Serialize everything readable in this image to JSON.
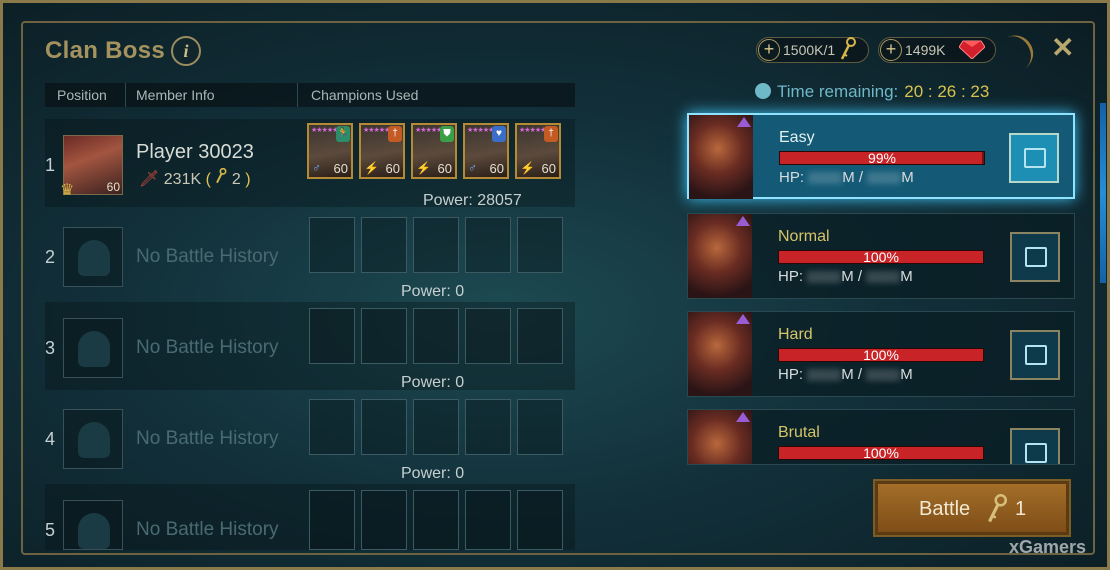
{
  "header": {
    "title": "Clan Boss",
    "info_icon": "i",
    "close_icon": "✕"
  },
  "resources": [
    {
      "value": "1500K/1",
      "icon": "key-icon"
    },
    {
      "value": "1499K",
      "icon": "ruby-icon"
    }
  ],
  "time": {
    "label": "Time remaining:",
    "value": "20 : 26 : 23"
  },
  "columns": {
    "position": "Position",
    "member": "Member Info",
    "champions": "Champions Used"
  },
  "rows": [
    {
      "num": "1",
      "name": "Player 30023",
      "level": "60",
      "damage": "231K",
      "keys": "2",
      "power": "Power: 28057",
      "champions": [
        {
          "level": "60",
          "stars": "★★★★★★"
        },
        {
          "level": "60",
          "stars": "★★★★★★"
        },
        {
          "level": "60",
          "stars": "★★★★★★"
        },
        {
          "level": "60",
          "stars": "★★★★★★"
        },
        {
          "level": "60",
          "stars": "★★★★★★"
        }
      ]
    },
    {
      "num": "2",
      "name": "No Battle History",
      "power": "Power: 0"
    },
    {
      "num": "3",
      "name": "No Battle History",
      "power": "Power: 0"
    },
    {
      "num": "4",
      "name": "No Battle History",
      "power": "Power: 0"
    },
    {
      "num": "5",
      "name": "No Battle History"
    }
  ],
  "difficulties": [
    {
      "name": "Easy",
      "hp_percent": 99,
      "hp_label": "99%",
      "hp_prefix": "HP:",
      "hp_sep": "M /",
      "hp_unit": "M"
    },
    {
      "name": "Normal",
      "hp_percent": 100,
      "hp_label": "100%",
      "hp_prefix": "HP:",
      "hp_sep": "M /",
      "hp_unit": "M"
    },
    {
      "name": "Hard",
      "hp_percent": 100,
      "hp_label": "100%",
      "hp_prefix": "HP:",
      "hp_sep": "M /",
      "hp_unit": "M"
    },
    {
      "name": "Brutal",
      "hp_percent": 100,
      "hp_label": "100%"
    }
  ],
  "battle": {
    "label": "Battle",
    "keys": "1"
  },
  "watermark": "xGamers",
  "colors": {
    "gold": "#a4935e",
    "hp_red": "#c82428",
    "active_glow": "#3fc3f5",
    "battle": "#a5702a"
  }
}
